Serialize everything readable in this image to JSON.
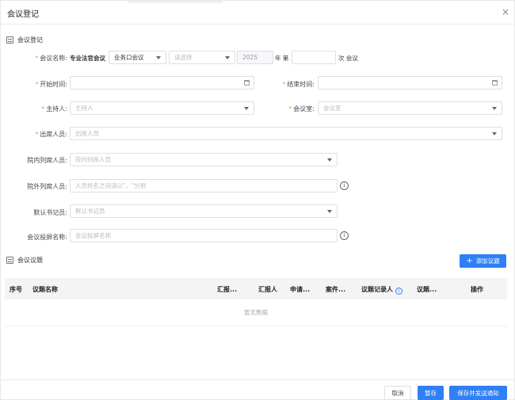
{
  "dialog": {
    "title": "会议登记",
    "close": "×"
  },
  "section1": {
    "title": "会议登记"
  },
  "meeting_name": {
    "label": "会议名称:",
    "prefix": "专业法官会议",
    "type_value": "业务口会议",
    "select_placeholder": "请选择",
    "year": "2025",
    "year_suffix": "年 第",
    "count_suffix": "次 会议"
  },
  "start_time": {
    "label": "开始时间:"
  },
  "end_time": {
    "label": "结束时间:"
  },
  "host": {
    "label": "主持人:",
    "placeholder": "主持人"
  },
  "room": {
    "label": "会议室:",
    "placeholder": "会议室"
  },
  "attendees": {
    "label": "出席人员:",
    "placeholder": "出席人员"
  },
  "inside_observers": {
    "label": "院内列席人员:",
    "placeholder": "院内列席人员"
  },
  "outside_observers": {
    "label": "院外列席人员:",
    "placeholder": "人员姓名之间请以\"、\"分割"
  },
  "secretary": {
    "label": "默认书记员:",
    "placeholder": "默认书记员"
  },
  "screen_name": {
    "label": "会议投屏名称:",
    "placeholder": "会议投屏名称"
  },
  "section2": {
    "title": "会议议题",
    "add_button": "添加议题"
  },
  "table": {
    "headers": [
      "序号",
      "议题名称",
      "汇报...",
      "汇报人",
      "申请...",
      "案件...",
      "议题记录人",
      "议题...",
      "操作"
    ],
    "empty": "暂无数据"
  },
  "footer": {
    "cancel": "取消",
    "save": "暂存",
    "send": "保存并发送通知"
  },
  "colors": {
    "primary": "#2f7ff5",
    "required": "#e6a23c"
  }
}
